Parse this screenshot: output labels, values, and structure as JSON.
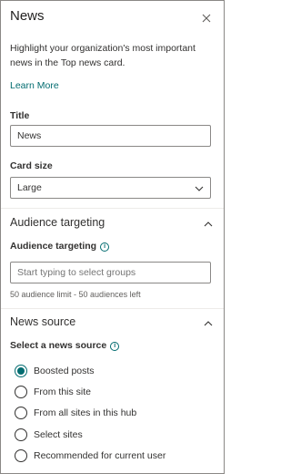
{
  "panel": {
    "title": "News",
    "description": "Highlight your organization's most important news in the Top news card.",
    "learn_more": "Learn More"
  },
  "title_field": {
    "label": "Title",
    "value": "News"
  },
  "card_size": {
    "label": "Card size",
    "selected": "Large"
  },
  "audience": {
    "section_title": "Audience targeting",
    "label": "Audience targeting",
    "placeholder": "Start typing to select groups",
    "hint": "50 audience limit - 50 audiences left"
  },
  "news_source": {
    "section_title": "News source",
    "label": "Select a news source",
    "options": [
      {
        "label": "Boosted posts",
        "checked": true
      },
      {
        "label": "From this site",
        "checked": false
      },
      {
        "label": "From all sites in this hub",
        "checked": false
      },
      {
        "label": "Select sites",
        "checked": false
      },
      {
        "label": "Recommended for current user",
        "checked": false
      }
    ]
  },
  "colors": {
    "accent": "#036c70",
    "border": "#8a8886",
    "text": "#323130"
  }
}
